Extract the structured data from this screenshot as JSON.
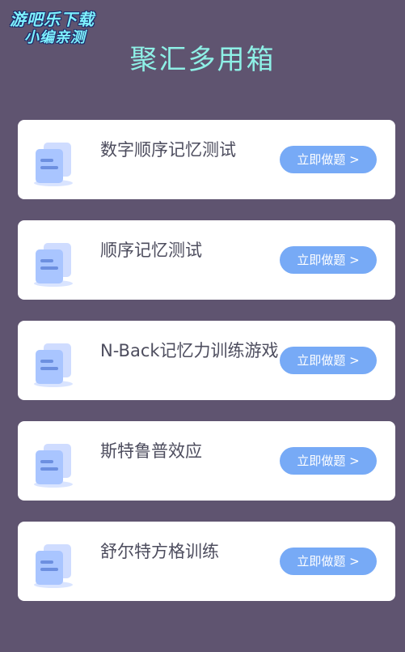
{
  "watermark": {
    "line1": "游吧乐下载",
    "line2": "小编亲测"
  },
  "header": {
    "title": "聚汇多用箱"
  },
  "colors": {
    "background": "#5f5470",
    "title": "#8ef0e6",
    "card": "#ffffff",
    "button": "#77aaf6",
    "icon_front": "#a9c5ff",
    "icon_back": "#cfdcff"
  },
  "cards": [
    {
      "title": "数字顺序记忆测试",
      "button_label": "立即做题 >",
      "icon": "document-stack-icon"
    },
    {
      "title": "顺序记忆测试",
      "button_label": "立即做题 >",
      "icon": "document-stack-icon"
    },
    {
      "title": "N-Back记忆力训练游戏",
      "button_label": "立即做题 >",
      "icon": "document-stack-icon"
    },
    {
      "title": "斯特鲁普效应",
      "button_label": "立即做题 >",
      "icon": "document-stack-icon"
    },
    {
      "title": "舒尔特方格训练",
      "button_label": "立即做题 >",
      "icon": "document-stack-icon"
    }
  ]
}
